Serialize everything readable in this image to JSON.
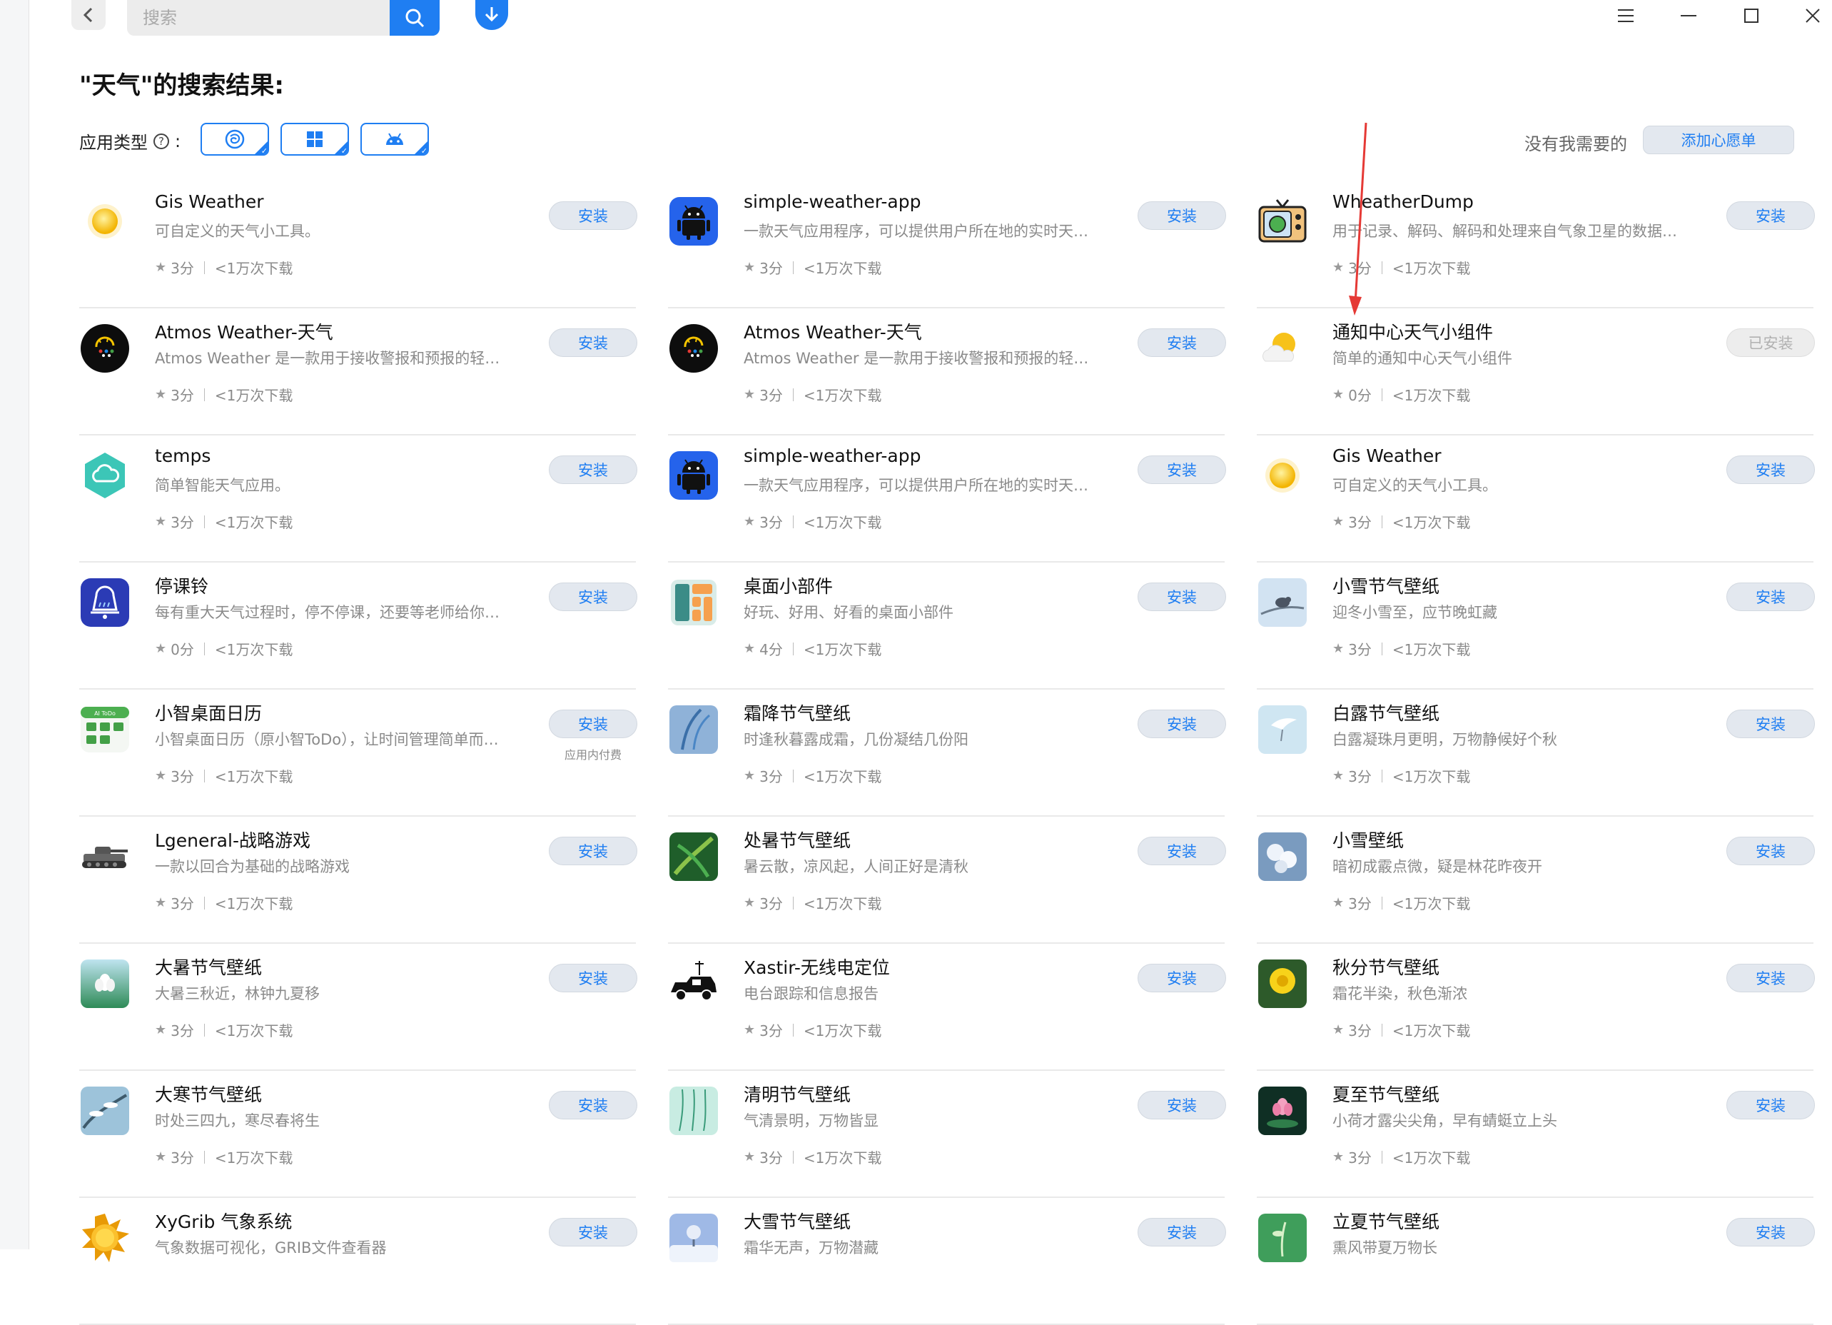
{
  "toolbar": {
    "search_placeholder": "搜索",
    "search_icon": "search-icon",
    "back_icon": "chevron-left-icon",
    "download_icon": "download-icon"
  },
  "window_controls": [
    "menu-icon",
    "minimize-icon",
    "maximize-icon",
    "close-icon"
  ],
  "page": {
    "title": "\"天气\"的搜索结果:"
  },
  "filters": {
    "label": "应用类型",
    "help_icon": "help-icon",
    "colon": ":",
    "types": [
      {
        "icon": "deepin-icon",
        "selected": true
      },
      {
        "icon": "windows-icon",
        "selected": true
      },
      {
        "icon": "android-icon",
        "selected": true
      }
    ]
  },
  "wishlist": {
    "text": "没有我需要的",
    "button": "添加心愿单"
  },
  "colors": {
    "accent": "#1f7ef2",
    "button_bg": "#e3e8ef",
    "annotation_arrow": "#e53935"
  },
  "results": [
    [
      {
        "name": "Gis Weather",
        "desc": "可自定义的天气小工具。",
        "rating": "3分",
        "downloads": "<1万次下载",
        "button": "安装",
        "icon": "sun-icon"
      },
      {
        "name": "Atmos Weather-天气",
        "desc": "Atmos Weather 是一款用于接收警报和预报的轻量…",
        "rating": "3分",
        "downloads": "<1万次下载",
        "button": "安装",
        "icon": "atmos-weather-icon"
      },
      {
        "name": "temps",
        "desc": "简单智能天气应用。",
        "rating": "3分",
        "downloads": "<1万次下载",
        "button": "安装",
        "icon": "temps-cloud-icon"
      },
      {
        "name": "停课铃",
        "desc": "每有重大天气过程时，停不停课，还要等老师给你打…",
        "rating": "0分",
        "downloads": "<1万次下载",
        "button": "安装",
        "icon": "school-bell-icon"
      },
      {
        "name": "小智桌面日历",
        "desc": "小智桌面日历（原小智ToDo），让时间管理简单而…",
        "rating": "3分",
        "downloads": "<1万次下载",
        "button": "安装",
        "sub": "应用内付费",
        "icon": "ai-todo-calendar-icon"
      },
      {
        "name": "Lgeneral-战略游戏",
        "desc": "一款以回合为基础的战略游戏",
        "rating": "3分",
        "downloads": "<1万次下载",
        "button": "安装",
        "icon": "tank-icon"
      },
      {
        "name": "大暑节气壁纸",
        "desc": "大暑三秋近，林钟九夏移",
        "rating": "3分",
        "downloads": "<1万次下载",
        "button": "安装",
        "icon": "lotus-wallpaper-icon"
      },
      {
        "name": "大寒节气壁纸",
        "desc": "时处三四九，寒尽春将生",
        "rating": "3分",
        "downloads": "<1万次下载",
        "button": "安装",
        "icon": "snow-branch-wallpaper-icon"
      },
      {
        "name": "XyGrib 气象系统",
        "desc": "气象数据可视化，GRIB文件查看器",
        "rating": "",
        "downloads": "",
        "button": "安装",
        "icon": "xygrib-sun-icon"
      }
    ],
    [
      {
        "name": "simple-weather-app",
        "desc": "一款天气应用程序，可以提供用户所在地的实时天气…",
        "rating": "3分",
        "downloads": "<1万次下载",
        "button": "安装",
        "icon": "android-app-icon"
      },
      {
        "name": "Atmos Weather-天气",
        "desc": "Atmos Weather 是一款用于接收警报和预报的轻量…",
        "rating": "3分",
        "downloads": "<1万次下载",
        "button": "安装",
        "icon": "atmos-weather-icon"
      },
      {
        "name": "simple-weather-app",
        "desc": "一款天气应用程序，可以提供用户所在地的实时天气…",
        "rating": "3分",
        "downloads": "<1万次下载",
        "button": "安装",
        "icon": "android-app-icon"
      },
      {
        "name": "桌面小部件",
        "desc": "好玩、好用、好看的桌面小部件",
        "rating": "4分",
        "downloads": "<1万次下载",
        "button": "安装",
        "icon": "widget-blocks-icon"
      },
      {
        "name": "霜降节气壁纸",
        "desc": "时逢秋暮露成霜，几份凝结几份阳",
        "rating": "3分",
        "downloads": "<1万次下载",
        "button": "安装",
        "icon": "frost-wallpaper-icon"
      },
      {
        "name": "处暑节气壁纸",
        "desc": "暑云散，凉风起，人间正好是清秋",
        "rating": "3分",
        "downloads": "<1万次下载",
        "button": "安装",
        "icon": "bamboo-wallpaper-icon"
      },
      {
        "name": "Xastir-无线电定位",
        "desc": "电台跟踪和信息报告",
        "rating": "3分",
        "downloads": "<1万次下载",
        "button": "安装",
        "icon": "radio-jeep-icon"
      },
      {
        "name": "清明节气壁纸",
        "desc": "气清景明，万物皆显",
        "rating": "3分",
        "downloads": "<1万次下载",
        "button": "安装",
        "icon": "willow-wallpaper-icon"
      },
      {
        "name": "大雪节气壁纸",
        "desc": "霜华无声，万物潜藏",
        "rating": "",
        "downloads": "",
        "button": "安装",
        "icon": "snow-tree-wallpaper-icon"
      }
    ],
    [
      {
        "name": "WheatherDump",
        "desc": "用于记录、解码、解码和处理来自气象卫星的数据的…",
        "rating": "3分",
        "downloads": "<1万次下载",
        "button": "安装",
        "icon": "tv-satellite-icon"
      },
      {
        "name": "通知中心天气小组件",
        "desc": "简单的通知中心天气小组件",
        "rating": "0分",
        "downloads": "<1万次下载",
        "button": "已安装",
        "installed": true,
        "icon": "sun-cloud-icon"
      },
      {
        "name": "Gis Weather",
        "desc": "可自定义的天气小工具。",
        "rating": "3分",
        "downloads": "<1万次下载",
        "button": "安装",
        "icon": "sun-icon"
      },
      {
        "name": "小雪节气壁纸",
        "desc": "迎冬小雪至，应节晚虹藏",
        "rating": "3分",
        "downloads": "<1万次下载",
        "button": "安装",
        "icon": "bird-wallpaper-icon"
      },
      {
        "name": "白露节气壁纸",
        "desc": "白露凝珠月更明，万物静候好个秋",
        "rating": "3分",
        "downloads": "<1万次下载",
        "button": "安装",
        "icon": "egret-wallpaper-icon"
      },
      {
        "name": "小雪壁纸",
        "desc": "暗初成霰点微，疑是林花昨夜开",
        "rating": "3分",
        "downloads": "<1万次下载",
        "button": "安装",
        "icon": "snow-flower-wallpaper-icon"
      },
      {
        "name": "秋分节气壁纸",
        "desc": "霜花半染，秋色渐浓",
        "rating": "3分",
        "downloads": "<1万次下载",
        "button": "安装",
        "icon": "chrysanthemum-wallpaper-icon"
      },
      {
        "name": "夏至节气壁纸",
        "desc": "小荷才露尖尖角，早有蜻蜓立上头",
        "rating": "3分",
        "downloads": "<1万次下载",
        "button": "安装",
        "icon": "lotus-night-wallpaper-icon"
      },
      {
        "name": "立夏节气壁纸",
        "desc": "熏风带夏万物长",
        "rating": "",
        "downloads": "",
        "button": "安装",
        "icon": "green-wallpaper-icon"
      }
    ]
  ]
}
